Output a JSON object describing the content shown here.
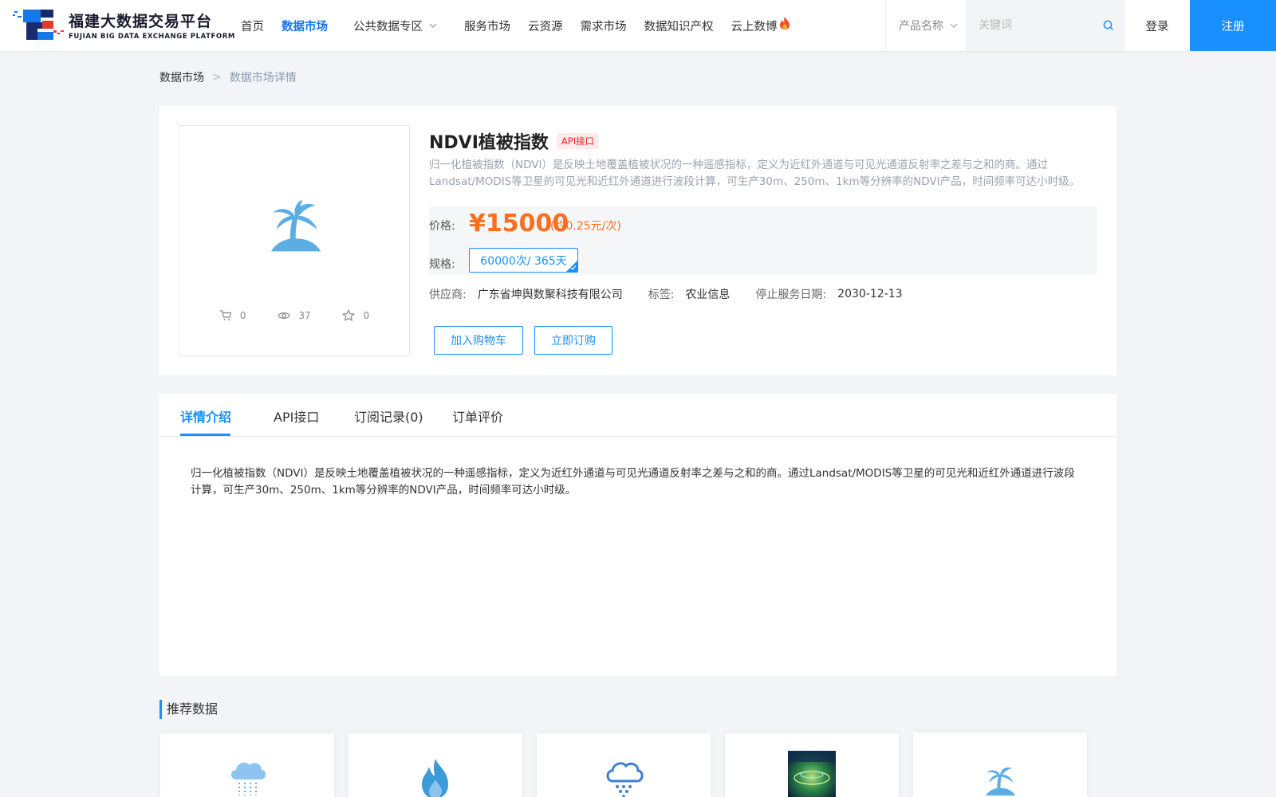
{
  "header": {
    "logo_cn": "福建大数据交易平台",
    "logo_en": "FUJIAN BIG DATA EXCHANGE  PLATFORM",
    "nav": [
      {
        "label": "首页",
        "active": false
      },
      {
        "label": "数据市场",
        "active": true
      },
      {
        "label": "公共数据专区",
        "active": false,
        "dropdown": true
      },
      {
        "label": "服务市场",
        "active": false
      },
      {
        "label": "云资源",
        "active": false
      },
      {
        "label": "需求市场",
        "active": false
      },
      {
        "label": "数据知识产权",
        "active": false
      },
      {
        "label": "云上数博",
        "active": false,
        "hot": true
      }
    ],
    "search_category": "产品名称",
    "search_placeholder": "关键词",
    "login": "登录",
    "register": "注册"
  },
  "breadcrumb": {
    "home": "数据市场",
    "separator": ">",
    "current": "数据市场详情"
  },
  "product": {
    "title": "NDVI植被指数",
    "badge": "API接口",
    "description": "归一化植被指数（NDVI）是反映土地覆盖植被状况的一种遥感指标，定义为近红外通道与可见光通道反射率之差与之和的商。通过Landsat/MODIS等卫星的可见光和近红外通道进行波段计算，可生产30m、250m、1km等分辨率的NDVI产品，时间频率可达小时级。",
    "icon": "palm-tree-icon",
    "stats": {
      "cart": "0",
      "views": "37",
      "favorites": "0"
    },
    "price_label": "价格:",
    "price": "¥15000",
    "price_unit": "(约0.25元/次)",
    "spec_label": "规格:",
    "spec_value": "60000次/ 365天",
    "supplier_label": "供应商:",
    "supplier": "广东省坤舆数聚科技有限公司",
    "tag_label": "标签:",
    "tag": "农业信息",
    "stop_label": "停止服务日期:",
    "stop_date": "2030-12-13",
    "add_cart": "加入购物车",
    "buy_now": "立即订购"
  },
  "tabs": [
    {
      "label": "详情介绍",
      "active": true
    },
    {
      "label": "API接口",
      "active": false
    },
    {
      "label": "订阅记录(0)",
      "active": false
    },
    {
      "label": "订单评价",
      "active": false
    }
  ],
  "detail_text": "归一化植被指数（NDVI）是反映土地覆盖植被状况的一种遥感指标，定义为近红外通道与可见光通道反射率之差与之和的商。通过Landsat/MODIS等卫星的可见光和近红外通道进行波段计算，可生产30m、250m、1km等分辨率的NDVI产品，时间频率可达小时级。",
  "recommend": {
    "title": "推荐数据",
    "items": [
      {
        "icon": "rain-cloud-icon"
      },
      {
        "icon": "fire-icon"
      },
      {
        "icon": "snow-cloud-icon"
      },
      {
        "icon": "satellite-image"
      },
      {
        "icon": "palm-tree-icon"
      }
    ]
  },
  "colors": {
    "primary": "#1890ff",
    "price": "#fa6e1e",
    "badge": "#f5222d",
    "icon": "#5aaee4"
  }
}
